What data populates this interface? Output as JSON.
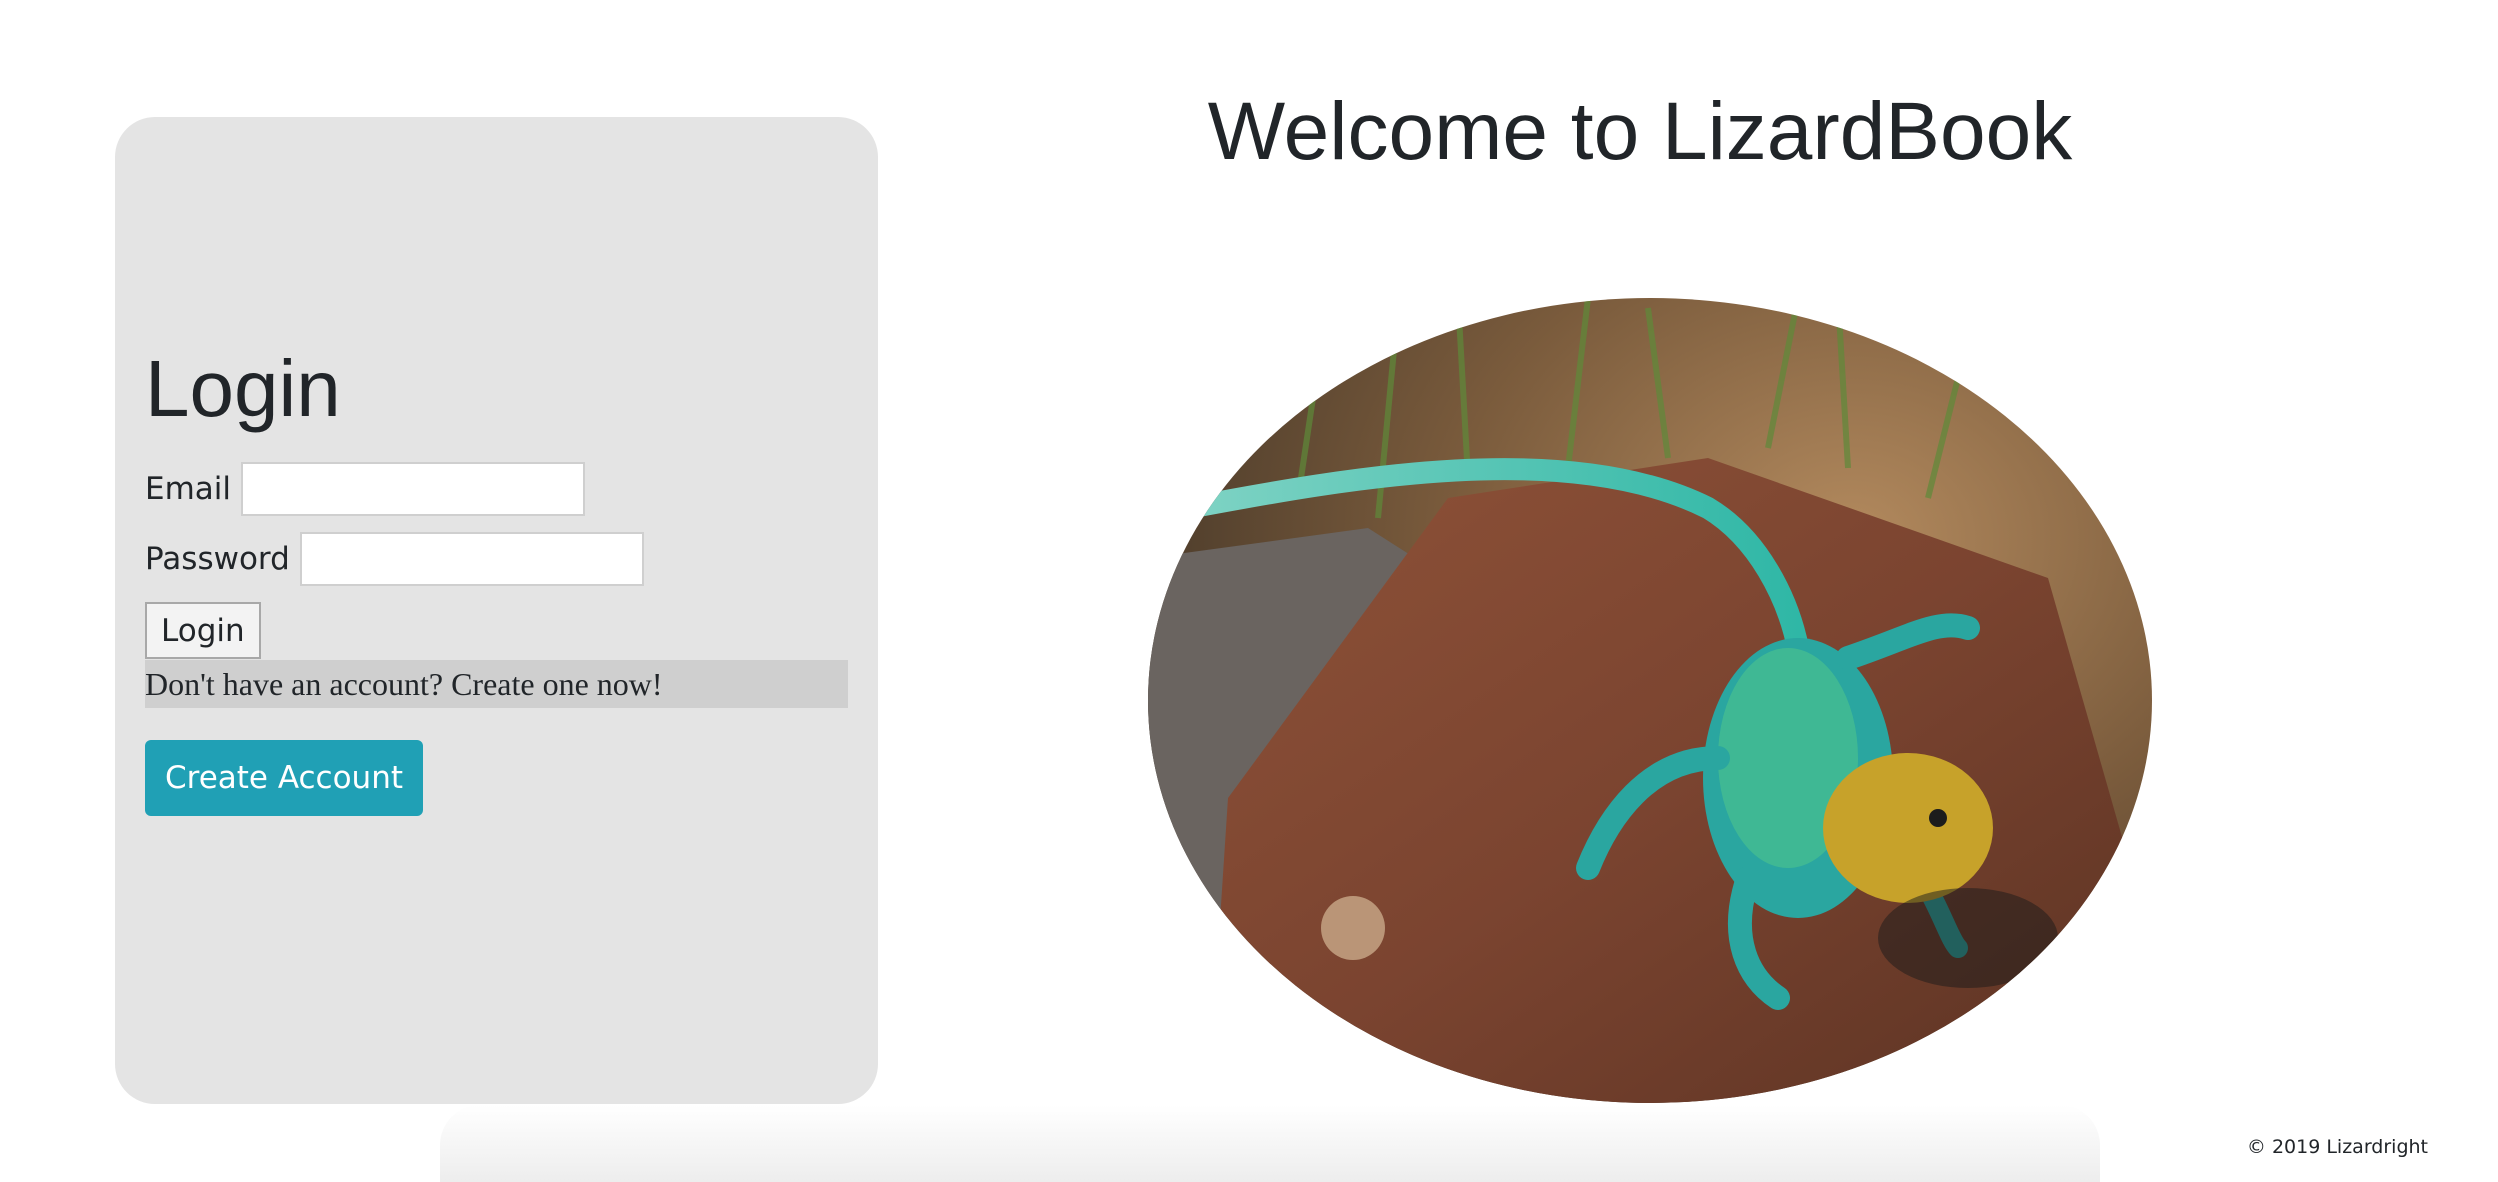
{
  "login": {
    "title": "Login",
    "email_label": "Email",
    "email_value": "",
    "password_label": "Password",
    "password_value": "",
    "login_button": "Login",
    "signup_prompt": "Don't have an account? Create one now!",
    "create_account_button": "Create Account"
  },
  "main": {
    "welcome_title": "Welcome to LizardBook"
  },
  "footer": {
    "copyright": "© 2019 Lizardright"
  },
  "colors": {
    "card_background": "#e4e4e4",
    "accent": "#20a0b5",
    "prompt_background": "#cfcfcf"
  }
}
